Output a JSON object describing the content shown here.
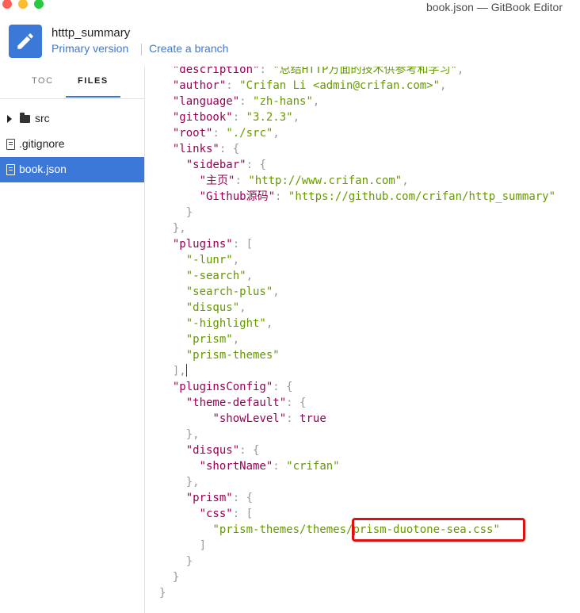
{
  "window": {
    "title": "book.json — GitBook Editor"
  },
  "header": {
    "book_name": "htttp_summary",
    "version_link": "Primary version",
    "branch_link": "Create a branch",
    "icon": "pencil-icon"
  },
  "sidebar": {
    "tabs": [
      "TOC",
      "FILES"
    ],
    "active_tab": "FILES",
    "files": [
      {
        "name": "src",
        "type": "folder",
        "icon": "folder-icon"
      },
      {
        "name": ".gitignore",
        "type": "file",
        "icon": "file-icon"
      },
      {
        "name": "book.json",
        "type": "file",
        "icon": "code-file-icon",
        "active": true
      }
    ]
  },
  "editor": {
    "lines": [
      "  \"description\": \"总结HTTP方面的技术供参考和学习\",",
      "  \"author\": \"Crifan Li <admin@crifan.com>\",",
      "  \"language\": \"zh-hans\",",
      "  \"gitbook\": \"3.2.3\",",
      "  \"root\": \"./src\",",
      "  \"links\": {",
      "    \"sidebar\": {",
      "      \"主页\": \"http://www.crifan.com\",",
      "      \"Github源码\": \"https://github.com/crifan/http_summary\"",
      "    }",
      "  },",
      "  \"plugins\": [",
      "    \"-lunr\",",
      "    \"-search\",",
      "    \"search-plus\",",
      "    \"disqus\",",
      "    \"-highlight\",",
      "    \"prism\",",
      "    \"prism-themes\"",
      "  ],",
      "  \"pluginsConfig\": {",
      "    \"theme-default\": {",
      "        \"showLevel\": true",
      "    },",
      "    \"disqus\": {",
      "      \"shortName\": \"crifan\"",
      "    },",
      "    \"prism\": {",
      "      \"css\": [",
      "        \"prism-themes/themes/prism-duotone-sea.css\"",
      "      ]",
      "    }",
      "  }",
      "}"
    ],
    "highlighted_text": "prism-duotone-sea.css\"",
    "colors": {
      "key": "#990055",
      "string": "#669900",
      "punctuation": "#999999",
      "highlight_border": "#e01010",
      "accent": "#3c78d8"
    }
  }
}
